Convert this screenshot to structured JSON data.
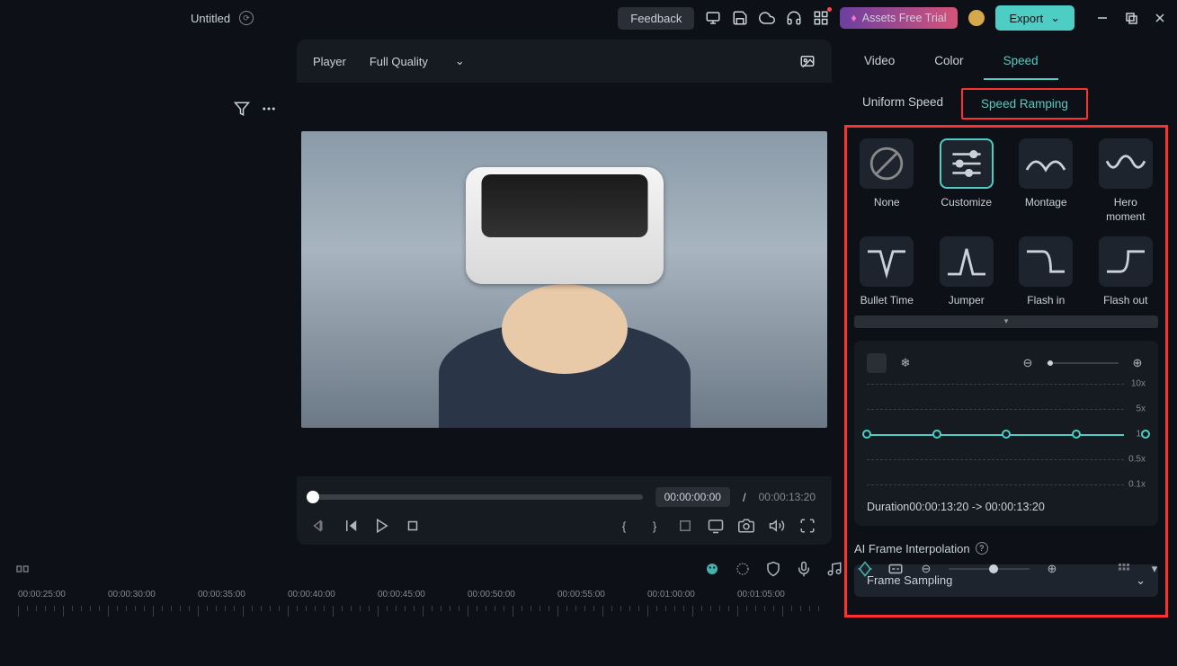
{
  "header": {
    "title": "Untitled",
    "feedback": "Feedback",
    "trial": "Assets Free Trial",
    "export": "Export"
  },
  "player": {
    "label": "Player",
    "quality": "Full Quality",
    "current_time": "00:00:00:00",
    "total_time": "00:00:13:20",
    "separator": "/"
  },
  "right": {
    "tabs": [
      "Video",
      "Color",
      "Speed"
    ],
    "active_tab_index": 2,
    "subtabs": [
      "Uniform Speed",
      "Speed Ramping"
    ],
    "active_subtab_index": 1,
    "presets": [
      {
        "label": "None"
      },
      {
        "label": "Customize"
      },
      {
        "label": "Montage"
      },
      {
        "label": "Hero moment"
      },
      {
        "label": "Bullet Time"
      },
      {
        "label": "Jumper"
      },
      {
        "label": "Flash in"
      },
      {
        "label": "Flash out"
      }
    ],
    "graph_labels": [
      "10x",
      "5x",
      "1x",
      "0.5x",
      "0.1x"
    ],
    "duration_label": "Duration",
    "duration_from": "00:00:13:20",
    "duration_arrow": "->",
    "duration_to": "00:00:13:20",
    "ai_label": "AI Frame Interpolation",
    "ai_value": "Frame Sampling"
  },
  "timeline": {
    "marks": [
      "00:00:25:00",
      "00:00:30:00",
      "00:00:35:00",
      "00:00:40:00",
      "00:00:45:00",
      "00:00:50:00",
      "00:00:55:00",
      "00:01:00:00",
      "00:01:05:00"
    ]
  }
}
